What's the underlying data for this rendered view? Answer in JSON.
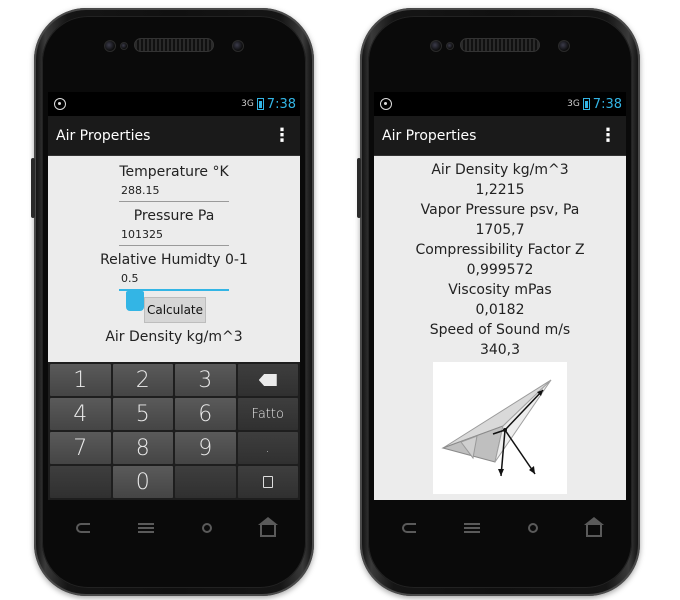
{
  "left_phone": {
    "status": {
      "network": "3G",
      "time": "7:38"
    },
    "app_title": "Air Properties",
    "fields": [
      {
        "label": "Temperature °K",
        "value": "288.15"
      },
      {
        "label": "Pressure Pa",
        "value": "101325"
      },
      {
        "label": "Relative Humidty 0-1",
        "value": "0.5"
      }
    ],
    "calculate_label": "Calculate",
    "partial_label": "Air Density kg/m^3",
    "keypad": {
      "row1": [
        "1",
        "2",
        "3"
      ],
      "row2": [
        "4",
        "5",
        "6"
      ],
      "row3": [
        "7",
        "8",
        "9"
      ],
      "row4": [
        "",
        "0",
        ""
      ],
      "done_label": "Fatto",
      "dot_label": "."
    }
  },
  "right_phone": {
    "status": {
      "network": "3G",
      "time": "7:38"
    },
    "app_title": "Air Properties",
    "results": [
      {
        "label": "Air Density kg/m^3",
        "value": "1,2215"
      },
      {
        "label": "Vapor Pressure psv, Pa",
        "value": "1705,7"
      },
      {
        "label": "Compressibility Factor Z",
        "value": "0,999572"
      },
      {
        "label": "Viscosity mPas",
        "value": "0,0182"
      },
      {
        "label": "Speed of Sound m/s",
        "value": "340,3"
      }
    ]
  },
  "icons": {
    "status": [
      "gps-icon",
      "signal-icon",
      "battery-icon"
    ],
    "nav": [
      "back-icon",
      "menu-icon",
      "search-icon",
      "home-icon"
    ],
    "overflow": "overflow-menu-icon"
  },
  "colors": {
    "accent": "#33b5e5",
    "actionbar": "#1a1a1a",
    "screen_bg": "#ececec"
  }
}
